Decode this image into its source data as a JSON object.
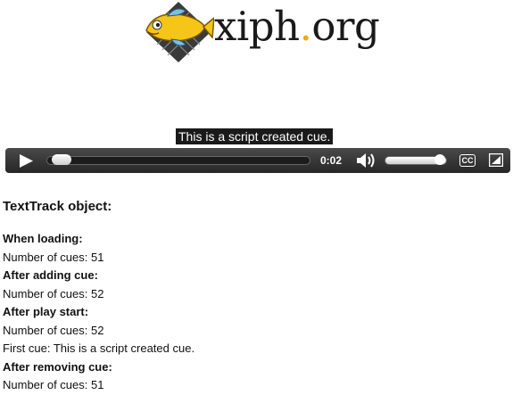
{
  "logo": {
    "name_main": "xiph",
    "name_dot": ".",
    "name_tld": "org",
    "icon": "xiph-fish-logo"
  },
  "video": {
    "cue_text": "This is a script created cue."
  },
  "controls": {
    "play_icon": "play-icon",
    "time": "0:02",
    "seek_position": 0.03,
    "volume_level": 1.0,
    "captions_label": "CC",
    "mute_icon": "speaker-icon",
    "fullscreen_icon": "fullscreen-icon"
  },
  "content": {
    "heading": "TextTrack object:",
    "entries": [
      {
        "label": "When loading:",
        "lines": [
          "Number of cues: 51"
        ]
      },
      {
        "label": "After adding cue:",
        "lines": [
          "Number of cues: 52"
        ]
      },
      {
        "label": "After play start:",
        "lines": [
          "Number of cues: 52",
          "First cue: This is a script created cue."
        ]
      },
      {
        "label": "After removing cue:",
        "lines": [
          "Number of cues: 51"
        ]
      }
    ]
  },
  "colors": {
    "accent_dot": "#f0a814",
    "fish_yellow": "#f5c518",
    "controls_bg": "#333333"
  }
}
